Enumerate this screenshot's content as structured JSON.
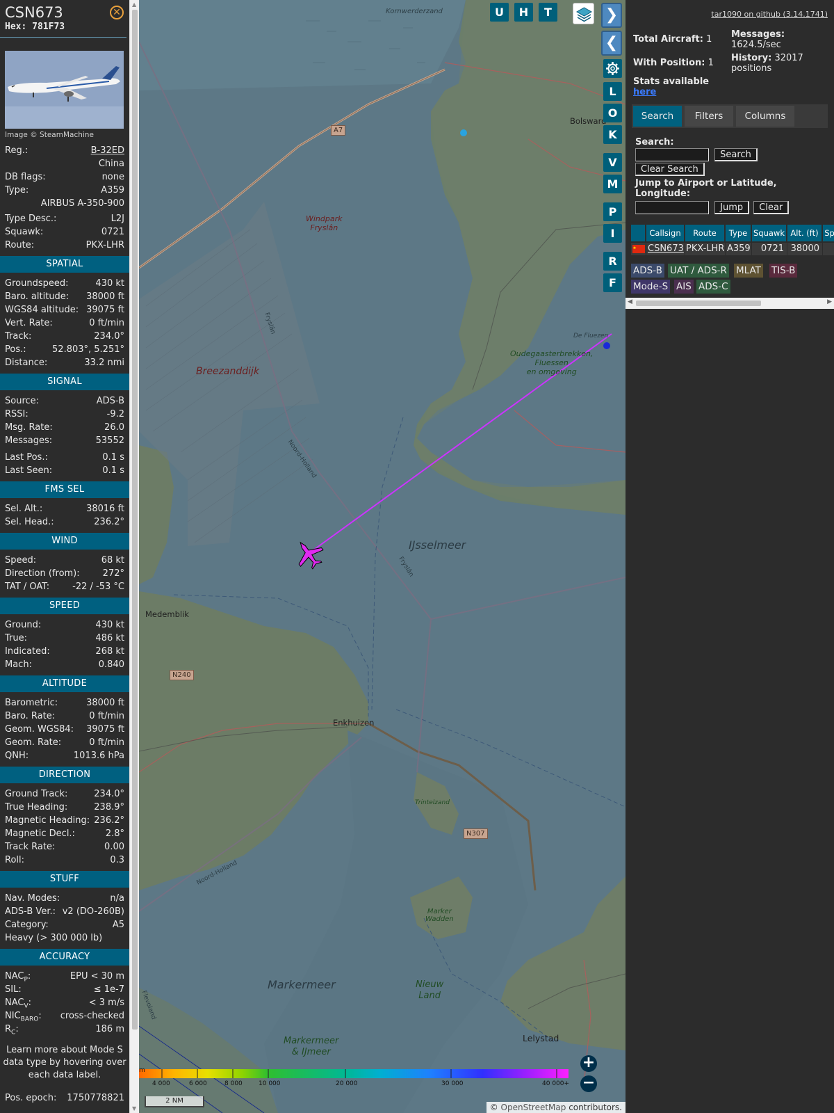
{
  "info": {
    "callsign": "CSN673",
    "hex": "Hex: 781F73",
    "photo_credit": "Image © SteamMachine",
    "reg_label": "Reg.:",
    "reg_value": "B-32ED",
    "country": "China",
    "dbflags_label": "DB flags:",
    "dbflags_value": "none",
    "type_label": "Type:",
    "type_value": "A359",
    "type_full": "AIRBUS A-350-900",
    "typedesc_label": "Type Desc.:",
    "typedesc_value": "L2J",
    "squawk_label": "Squawk:",
    "squawk_value": "0721",
    "route_label": "Route:",
    "route_value": "PKX-LHR",
    "sections": {
      "spatial": "SPATIAL",
      "signal": "SIGNAL",
      "fms": "FMS SEL",
      "wind": "WIND",
      "speed": "SPEED",
      "altitude": "ALTITUDE",
      "direction": "DIRECTION",
      "stuff": "STUFF",
      "accuracy": "ACCURACY"
    },
    "spatial": [
      {
        "k": "Groundspeed:",
        "v": "430 kt"
      },
      {
        "k": "Baro. altitude:",
        "v": "38000 ft"
      },
      {
        "k": "WGS84 altitude:",
        "v": "39075 ft"
      },
      {
        "k": "Vert. Rate:",
        "v": "0 ft/min"
      },
      {
        "k": "Track:",
        "v": "234.0°"
      },
      {
        "k": "Pos.:",
        "v": "52.803°, 5.251°"
      },
      {
        "k": "Distance:",
        "v": "33.2 nmi"
      }
    ],
    "signal": [
      {
        "k": "Source:",
        "v": "ADS-B"
      },
      {
        "k": "RSSI:",
        "v": "-9.2"
      },
      {
        "k": "Msg. Rate:",
        "v": "26.0"
      },
      {
        "k": "Messages:",
        "v": "53552"
      },
      {
        "k": "Last Pos.:",
        "v": "0.1 s"
      },
      {
        "k": "Last Seen:",
        "v": "0.1 s"
      }
    ],
    "fms": [
      {
        "k": "Sel. Alt.:",
        "v": "38016 ft"
      },
      {
        "k": "Sel. Head.:",
        "v": "236.2°"
      }
    ],
    "wind": [
      {
        "k": "Speed:",
        "v": "68 kt"
      },
      {
        "k": "Direction (from):",
        "v": "272°"
      },
      {
        "k": "TAT / OAT:",
        "v": "-22 / -53 °C"
      }
    ],
    "speed": [
      {
        "k": "Ground:",
        "v": "430 kt"
      },
      {
        "k": "True:",
        "v": "486 kt"
      },
      {
        "k": "Indicated:",
        "v": "268 kt"
      },
      {
        "k": "Mach:",
        "v": "0.840"
      }
    ],
    "altitude": [
      {
        "k": "Barometric:",
        "v": "38000 ft"
      },
      {
        "k": "Baro. Rate:",
        "v": "0 ft/min"
      },
      {
        "k": "Geom. WGS84:",
        "v": "39075 ft"
      },
      {
        "k": "Geom. Rate:",
        "v": "0 ft/min"
      },
      {
        "k": "QNH:",
        "v": "1013.6 hPa"
      }
    ],
    "direction": [
      {
        "k": "Ground Track:",
        "v": "234.0°"
      },
      {
        "k": "True Heading:",
        "v": "238.9°"
      },
      {
        "k": "Magnetic Heading:",
        "v": "236.2°"
      },
      {
        "k": "Magnetic Decl.:",
        "v": "2.8°"
      },
      {
        "k": "Track Rate:",
        "v": "0.00"
      },
      {
        "k": "Roll:",
        "v": "0.3"
      }
    ],
    "stuff": [
      {
        "k": "Nav. Modes:",
        "v": "n/a"
      },
      {
        "k": "ADS-B Ver.:",
        "v": "v2 (DO-260B)"
      },
      {
        "k": "Category:",
        "v": "A5"
      }
    ],
    "category_desc": "Heavy (> 300 000 lb)",
    "accuracy": {
      "nacp_k": "NAC",
      "nacp_sub": "P",
      "nacp_v": "EPU < 30 m",
      "sil_k": "SIL:",
      "sil_v": "≤ 1e-7",
      "nacv_k": "NAC",
      "nacv_sub": "V",
      "nacv_v": "< 3 m/s",
      "nicbaro_k": "NIC",
      "nicbaro_sub": "BARO",
      "nicbaro_v": "cross-checked",
      "rc_k": "R",
      "rc_sub": "C",
      "rc_v": "186 m"
    },
    "learn_more": "Learn more about Mode S data type by hovering over each data label.",
    "epoch_label": "Pos. epoch:",
    "epoch_value": "1750778821"
  },
  "map": {
    "buttons_top": [
      "U",
      "H",
      "T"
    ],
    "buttons_side": [
      "L",
      "O",
      "K",
      "V",
      "M",
      "P",
      "I",
      "R",
      "F"
    ],
    "labels": {
      "kornwerderzand": "Kornwerderzand",
      "windpark": "Windpark\nFryslân",
      "breezanddijk": "Breezanddijk",
      "ijsselmeer": "IJsselmeer",
      "medemblik": "Medemblik",
      "enkhuizen": "Enkhuizen",
      "trintelzand": "Trintelzand",
      "markerwadden": "Marker\nWadden",
      "markermeer": "Markermeer",
      "nieuwland": "Nieuw\nLand",
      "markermeer_ijmeer": "Markermeer\n& IJmeer",
      "lelystad": "Lelystad",
      "bolsward": "Bolsward",
      "oudegaaster": "Oudegaasterbrekken,\nFluessen\nen omgeving",
      "defluezen": "De Fluezen",
      "fryslan1": "Fryslân",
      "fryslan2": "Fryslân",
      "noordholland1": "Noord-Holland",
      "noordholland2": "Noord-Holland",
      "flevoland": "Flevoland"
    },
    "shields": {
      "a7": "A7",
      "n240": "N240",
      "n307": "N307"
    },
    "colorbar_labels": [
      "4 000",
      "6 000",
      "8 000",
      "10 000",
      "20 000",
      "30 000",
      "40 000+"
    ],
    "colorbar_m": "m",
    "scale": "2 NM",
    "attribution_prefix": "©",
    "attribution_link": "OpenStreetMap",
    "attribution_suffix": "contributors.",
    "zoom_in": "+",
    "zoom_out": "−"
  },
  "sidebar": {
    "version": "tar1090 on github (3.14.1741)",
    "total_label": "Total Aircraft:",
    "total_value": "1",
    "withpos_label": "With Position:",
    "withpos_value": "1",
    "messages_label": "Messages:",
    "messages_value": "1624.5/sec",
    "history_label": "History:",
    "history_value": "32017 positions",
    "stats_label": "Stats available",
    "stats_link": "here",
    "tabs": [
      "Search",
      "Filters",
      "Columns"
    ],
    "search_label": "Search:",
    "search_btn": "Search",
    "clear_search_btn": "Clear Search",
    "jump_label": "Jump to Airport or Latitude, Longitude:",
    "jump_btn": "Jump",
    "clear_btn": "Clear",
    "table_headers": [
      "Callsign",
      "Route",
      "Type",
      "Squawk",
      "Alt. (ft)",
      "Sp"
    ],
    "table_row": {
      "callsign": "CSN673",
      "route": "PKX-LHR",
      "type": "A359",
      "squawk": "0721",
      "alt": "38000"
    },
    "legend": [
      "ADS-B",
      "UAT / ADS-R",
      "MLAT",
      "TIS-B",
      "Mode-S",
      "AIS",
      "ADS-C"
    ]
  },
  "colors": {
    "accent": "#00617f",
    "track": "#cc33ff",
    "aircraft": "#e02bf0"
  }
}
